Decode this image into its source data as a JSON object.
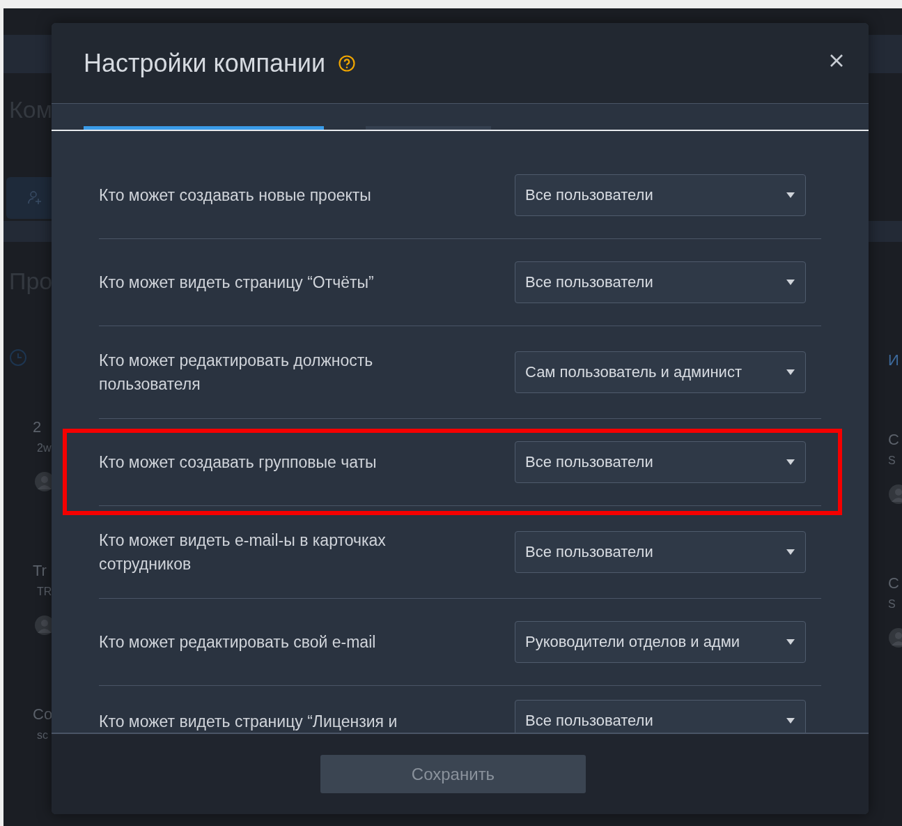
{
  "background": {
    "left": [
      {
        "kind": "heading",
        "text": "Ком"
      },
      {
        "kind": "add-user-button"
      },
      {
        "kind": "heading",
        "text": "Про"
      },
      {
        "kind": "clock"
      },
      {
        "kind": "title",
        "text": "2"
      },
      {
        "kind": "sub",
        "text": "2w"
      },
      {
        "kind": "avatar"
      },
      {
        "kind": "title",
        "text": "Tr"
      },
      {
        "kind": "sub",
        "text": "TR"
      },
      {
        "kind": "avatar"
      },
      {
        "kind": "title",
        "text": "Co"
      },
      {
        "kind": "sub",
        "text": "sc"
      }
    ],
    "right": [
      {
        "kind": "link",
        "text": "И"
      },
      {
        "kind": "title",
        "text": "C"
      },
      {
        "kind": "sub",
        "text": "S"
      },
      {
        "kind": "avatar"
      },
      {
        "kind": "title",
        "text": "C"
      },
      {
        "kind": "sub",
        "text": "S"
      },
      {
        "kind": "avatar"
      }
    ]
  },
  "modal": {
    "title": "Настройки компании",
    "tabs": [
      {
        "selected": true
      },
      {
        "selected": false
      }
    ],
    "settings": [
      {
        "label": "Кто может создавать новые проекты",
        "value": "Все пользователи",
        "highlighted": false
      },
      {
        "label": "Кто может видеть страницу “Отчёты”",
        "value": "Все пользователи",
        "highlighted": false
      },
      {
        "label": "Кто может редактировать должность пользователя",
        "value": "Сам пользователь и админист",
        "highlighted": false
      },
      {
        "label": "Кто может создавать групповые чаты",
        "value": "Все пользователи",
        "highlighted": true
      },
      {
        "label": "Кто может видеть e-mail-ы в карточках сотрудников",
        "value": "Все пользователи",
        "highlighted": false
      },
      {
        "label": "Кто может редактировать свой e-mail",
        "value": "Руководители отделов и адми",
        "highlighted": false
      },
      {
        "label": "Кто может видеть страницу “Лицензия и",
        "value": "Все пользователи",
        "highlighted": false
      }
    ],
    "save_button": {
      "label": "Сохранить",
      "disabled": true
    }
  }
}
